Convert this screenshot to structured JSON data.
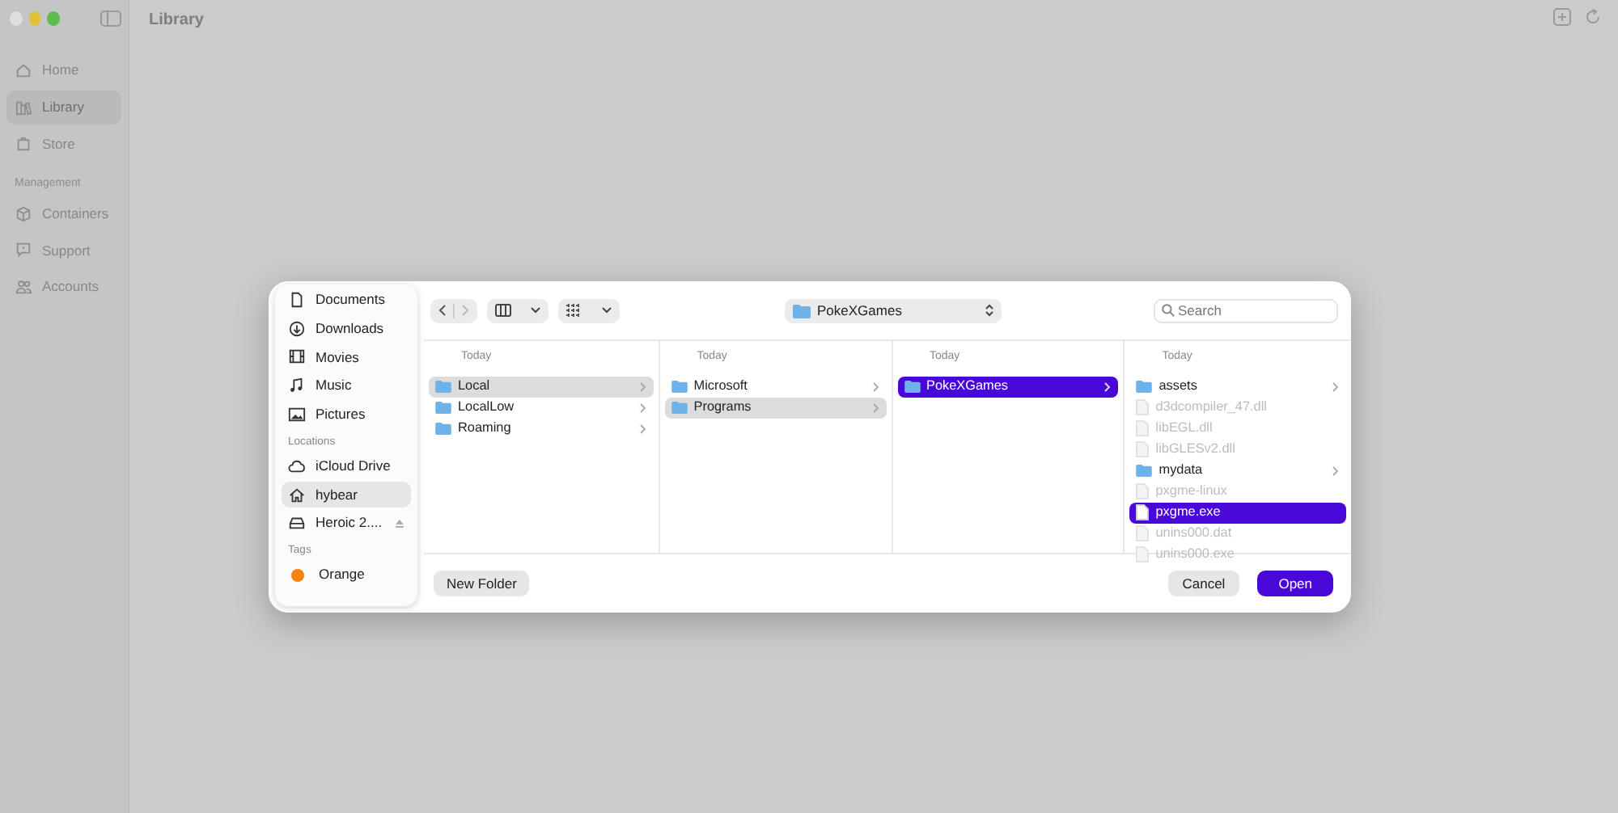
{
  "app": {
    "title": "Library",
    "sidebar": {
      "items": [
        {
          "label": "Home",
          "selected": false
        },
        {
          "label": "Library",
          "selected": true
        },
        {
          "label": "Store",
          "selected": false
        }
      ],
      "section": "Management",
      "section_items": [
        {
          "label": "Containers",
          "selected": false
        },
        {
          "label": "Support",
          "selected": false
        },
        {
          "label": "Accounts",
          "selected": false
        }
      ]
    }
  },
  "dialog": {
    "sidebar": {
      "favorites": [
        {
          "label": "Documents",
          "selected": false
        },
        {
          "label": "Downloads",
          "selected": false
        },
        {
          "label": "Movies",
          "selected": false
        },
        {
          "label": "Music",
          "selected": false
        },
        {
          "label": "Pictures",
          "selected": false
        }
      ],
      "locations_heading": "Locations",
      "locations": [
        {
          "label": "iCloud Drive",
          "selected": false
        },
        {
          "label": "hybear",
          "selected": true
        },
        {
          "label": "Heroic 2....",
          "selected": false
        }
      ],
      "tags_heading": "Tags",
      "tags": [
        {
          "label": "Orange",
          "color": "#f5820b"
        }
      ]
    },
    "toolbar": {
      "path": "PokeXGames",
      "search": {
        "placeholder": "Search"
      }
    },
    "columns": [
      {
        "header": "Today",
        "active": false,
        "items": [
          {
            "name": "Local",
            "kind": "folder",
            "selected": true,
            "disabled": false
          },
          {
            "name": "LocalLow",
            "kind": "folder",
            "selected": false,
            "disabled": false
          },
          {
            "name": "Roaming",
            "kind": "folder",
            "selected": false,
            "disabled": false
          }
        ]
      },
      {
        "header": "Today",
        "active": false,
        "items": [
          {
            "name": "Microsoft",
            "kind": "folder",
            "selected": false,
            "disabled": false
          },
          {
            "name": "Programs",
            "kind": "folder",
            "selected": true,
            "disabled": false
          }
        ]
      },
      {
        "header": "Today",
        "active": true,
        "items": [
          {
            "name": "PokeXGames",
            "kind": "folder",
            "selected": true,
            "disabled": false
          }
        ]
      },
      {
        "header": "Today",
        "active": true,
        "items": [
          {
            "name": "assets",
            "kind": "folder",
            "selected": false,
            "disabled": false
          },
          {
            "name": "d3dcompiler_47.dll",
            "kind": "file",
            "selected": false,
            "disabled": true
          },
          {
            "name": "libEGL.dll",
            "kind": "file",
            "selected": false,
            "disabled": true
          },
          {
            "name": "libGLESv2.dll",
            "kind": "file",
            "selected": false,
            "disabled": true
          },
          {
            "name": "mydata",
            "kind": "folder",
            "selected": false,
            "disabled": false
          },
          {
            "name": "pxgme-linux",
            "kind": "file",
            "selected": false,
            "disabled": true
          },
          {
            "name": "pxgme.exe",
            "kind": "file",
            "selected": true,
            "disabled": false
          },
          {
            "name": "unins000.dat",
            "kind": "file",
            "selected": false,
            "disabled": true
          },
          {
            "name": "unins000.exe",
            "kind": "file",
            "selected": false,
            "disabled": true
          }
        ]
      }
    ],
    "buttons": {
      "new_folder": "New Folder",
      "cancel": "Cancel",
      "open": "Open"
    }
  }
}
